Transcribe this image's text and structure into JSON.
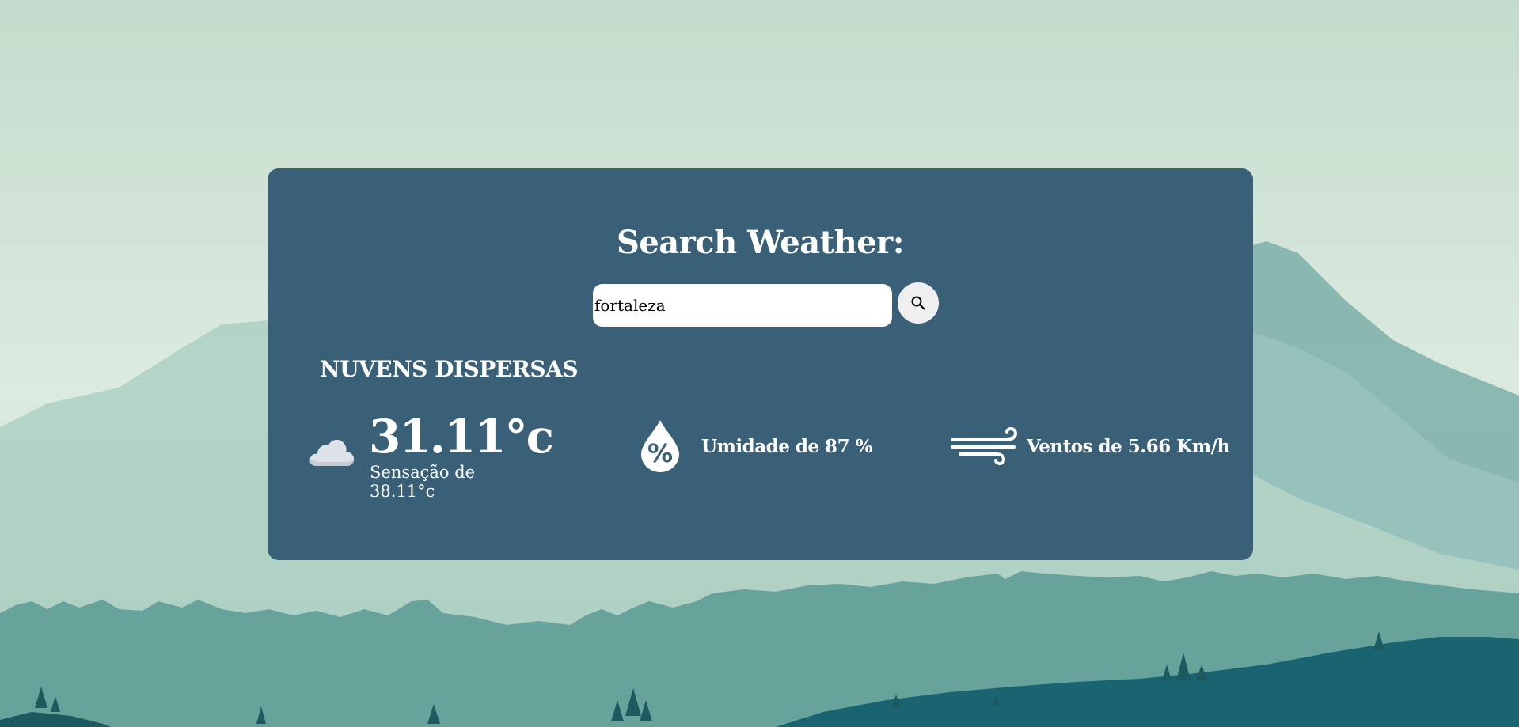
{
  "search": {
    "title": "Search Weather:",
    "input_value": "fortaleza",
    "button_icon": "search-icon"
  },
  "weather": {
    "description": "NUVENS DISPERSAS",
    "condition_icon": "cloud-icon",
    "temperature": "31.11°c",
    "feels_like": "Sensação de 38.11°c",
    "humidity_icon": "humidity-drop-icon",
    "humidity": "Umidade de 87 %",
    "wind_icon": "wind-icon",
    "wind": "Ventos de 5.66 Km/h"
  },
  "colors": {
    "card": "#3a6078",
    "text": "#ffffff",
    "background_sky": "#c5dccd",
    "mountain_far": "#8fbdb4",
    "hills_mid": "#66a39b",
    "hills_front": "#1a6472"
  }
}
